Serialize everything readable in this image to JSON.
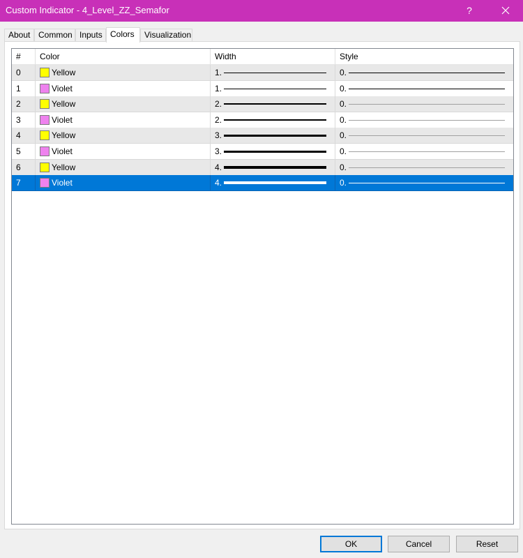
{
  "window": {
    "title": "Custom Indicator - 4_Level_ZZ_Semafor",
    "help_glyph": "?",
    "accent_color": "#c830b8"
  },
  "tabs": [
    {
      "label": "About"
    },
    {
      "label": "Common"
    },
    {
      "label": "Inputs"
    },
    {
      "label": "Colors",
      "active": true
    },
    {
      "label": "Visualization"
    }
  ],
  "grid": {
    "headers": {
      "num": "#",
      "color": "Color",
      "width": "Width",
      "style": "Style"
    },
    "rows": [
      {
        "num": "0",
        "color_name": "Yellow",
        "swatch": "#ffff00",
        "width_label": "1.",
        "width": 1,
        "style_label": "0.",
        "style_color": "#000000"
      },
      {
        "num": "1",
        "color_name": "Violet",
        "swatch": "#ee82ee",
        "width_label": "1.",
        "width": 1,
        "style_label": "0.",
        "style_color": "#000000"
      },
      {
        "num": "2",
        "color_name": "Yellow",
        "swatch": "#ffff00",
        "width_label": "2.",
        "width": 2,
        "style_label": "0.",
        "style_color": "#a0a0a0"
      },
      {
        "num": "3",
        "color_name": "Violet",
        "swatch": "#ee82ee",
        "width_label": "2.",
        "width": 2,
        "style_label": "0.",
        "style_color": "#a0a0a0"
      },
      {
        "num": "4",
        "color_name": "Yellow",
        "swatch": "#ffff00",
        "width_label": "3.",
        "width": 3,
        "style_label": "0.",
        "style_color": "#a0a0a0"
      },
      {
        "num": "5",
        "color_name": "Violet",
        "swatch": "#ee82ee",
        "width_label": "3.",
        "width": 3,
        "style_label": "0.",
        "style_color": "#a0a0a0"
      },
      {
        "num": "6",
        "color_name": "Yellow",
        "swatch": "#ffff00",
        "width_label": "4.",
        "width": 4,
        "style_label": "0.",
        "style_color": "#a0a0a0"
      },
      {
        "num": "7",
        "color_name": "Violet",
        "swatch": "#ee82ee",
        "width_label": "4.",
        "width": 4,
        "style_label": "0.",
        "style_color": "#ffffff",
        "selected": true
      }
    ]
  },
  "buttons": {
    "ok": "OK",
    "cancel": "Cancel",
    "reset": "Reset"
  }
}
